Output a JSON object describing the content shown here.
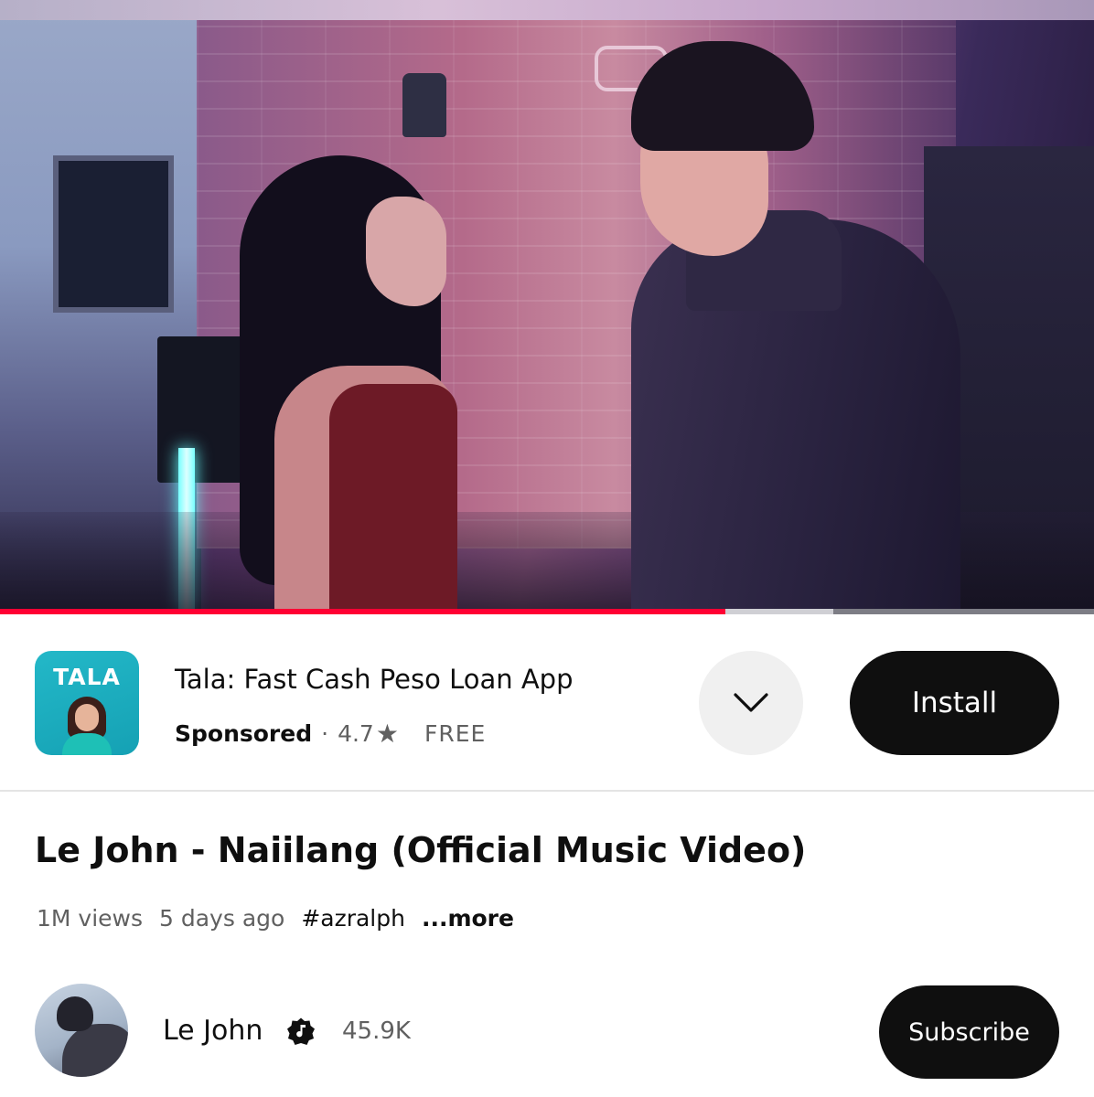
{
  "player": {
    "progress_played_fraction": 0.663,
    "progress_buffered_fraction": 0.762,
    "colors": {
      "played": "#ff0033",
      "buffered": "#cfcfd4",
      "track": "#7d7d85"
    }
  },
  "ad": {
    "app_icon_text": "TALA",
    "title": "Tala: Fast Cash Peso Loan App",
    "sponsored_label": "Sponsored",
    "separator": "·",
    "rating": "4.7",
    "star_icon": "★",
    "price": "FREE",
    "expand_icon": "chevron-down-icon",
    "install_label": "Install"
  },
  "video": {
    "title": "Le John - Naiilang (Official Music Video)",
    "views": "1M views",
    "age": "5 days ago",
    "hashtag": "#azralph",
    "more_label": "...more"
  },
  "channel": {
    "name": "Le John",
    "verified_icon": "verified-music-icon",
    "subscribers": "45.9K",
    "subscribe_label": "Subscribe"
  }
}
